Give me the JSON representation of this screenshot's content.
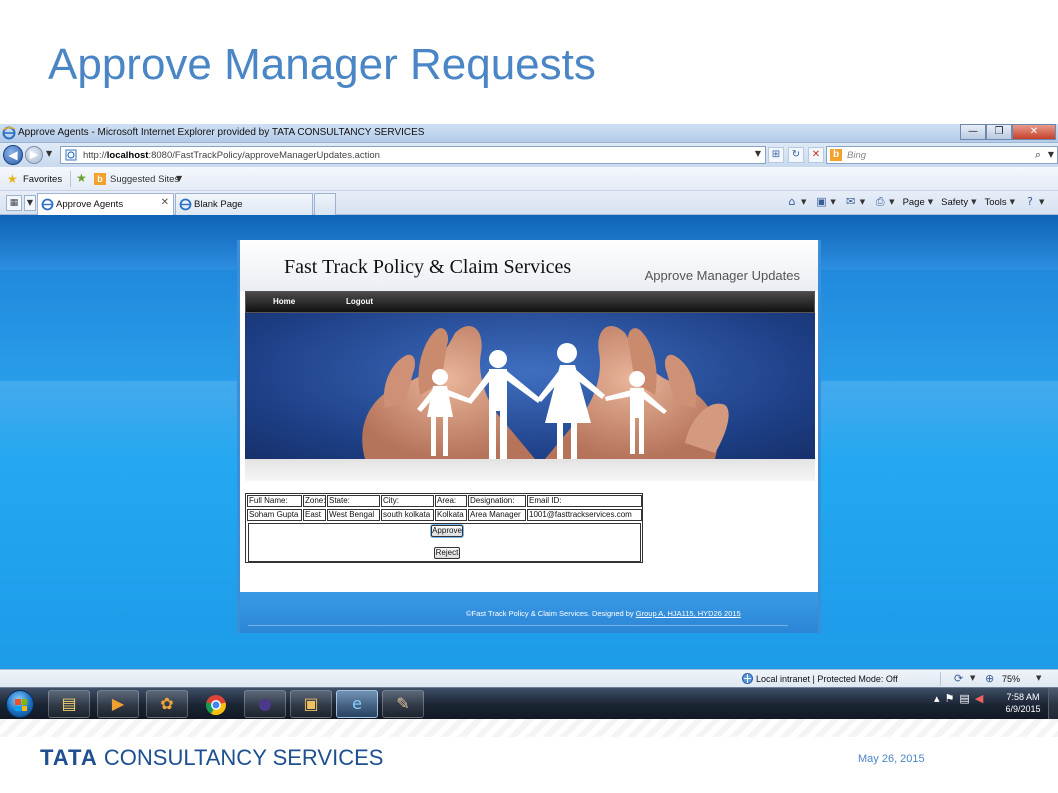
{
  "slide": {
    "title": "Approve Manager Requests",
    "date": "May 26, 2015",
    "logo_text": {
      "tata": "TATA",
      "rest": "CONSULTANCY SERVICES"
    }
  },
  "browser": {
    "window_title": "Approve Agents - Microsoft Internet Explorer provided by TATA CONSULTANCY SERVICES",
    "url_prefix": "http://",
    "url_host": "localhost",
    "url_rest": ":8080/FastTrackPolicy/approveManagerUpdates.action",
    "search_placeholder": "Bing",
    "favorites_label": "Favorites",
    "suggested_sites_label": "Suggested Sites",
    "tabs": [
      {
        "label": "Approve Agents",
        "active": true
      },
      {
        "label": "Blank Page",
        "active": false
      }
    ],
    "command_bar": {
      "page": "Page",
      "safety": "Safety",
      "tools": "Tools"
    },
    "status": {
      "zone": "Local intranet | Protected Mode: Off",
      "zoom": "75%"
    }
  },
  "app": {
    "title": "Fast Track Policy & Claim Services",
    "subtitle": "Approve Manager Updates",
    "nav": {
      "home": "Home",
      "logout": "Logout"
    },
    "table": {
      "headers": [
        "Full Name:",
        "Zone:",
        "State:",
        "City:",
        "Area:",
        "Designation:",
        "Email ID:"
      ],
      "row": [
        "Soham Gupta",
        "East",
        "West Bengal",
        "south kolkata",
        "Kolkata",
        "Area Manager",
        "1001@fasttrackservices.com"
      ]
    },
    "approve_label": "Approve",
    "reject_label": "Reject",
    "footer_text": "©Fast Track Policy & Claim Services. Designed by",
    "footer_link": "Group A, HJA115, HYD26 2015"
  },
  "taskbar": {
    "time": "7:58 AM",
    "date": "6/9/2015"
  },
  "colors": {
    "slide_title": "#4a86c5",
    "page_bg": "#23a8f1",
    "banner_bg": "#1e3f86",
    "tcs_blue": "#1d4f91"
  },
  "icons": [
    "ie-icon",
    "back-icon",
    "forward-icon",
    "refresh-icon",
    "stop-icon",
    "bing-icon",
    "favorites-star-icon",
    "home-icon",
    "feeds-icon",
    "mail-icon",
    "print-icon",
    "help-icon",
    "windows-start-icon",
    "explorer-icon",
    "media-player-icon",
    "chrome-icon",
    "eclipse-icon",
    "paint-icon"
  ]
}
